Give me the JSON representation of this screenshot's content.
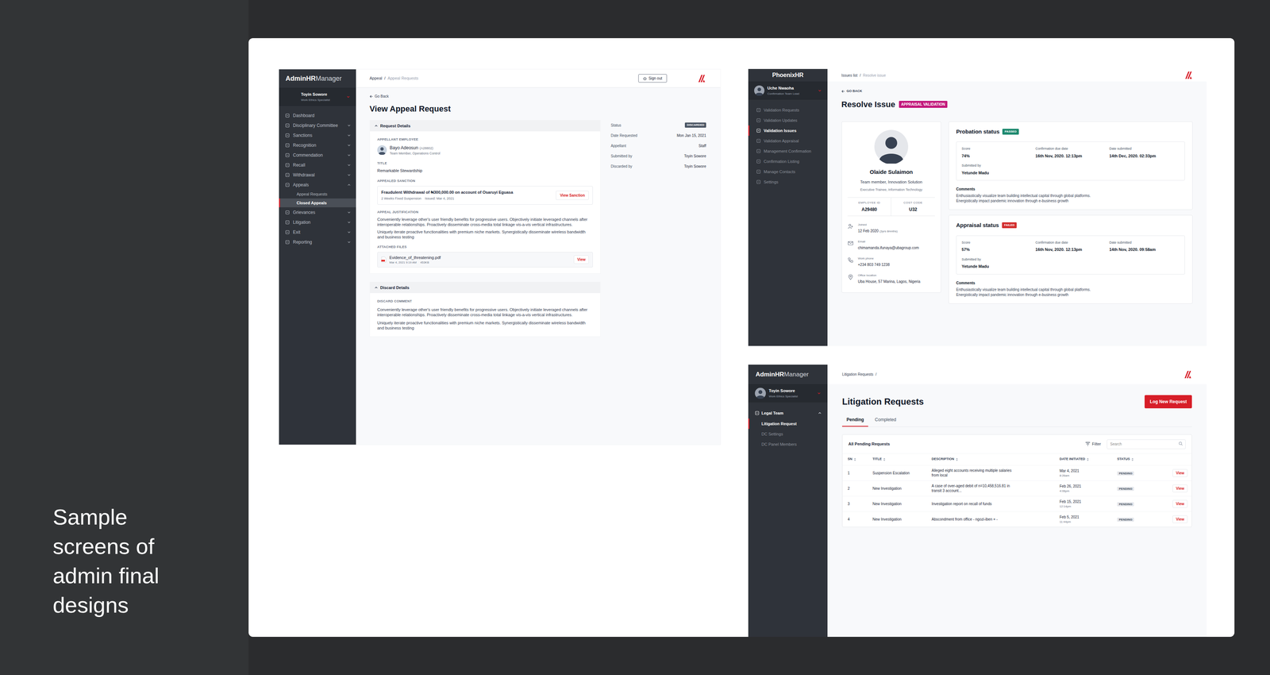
{
  "slide": {
    "caption": "Sample screens of admin final designs"
  },
  "appeal_screen": {
    "sidebar": {
      "brand_bold": "AdminHR",
      "brand_light": "Manager",
      "user": {
        "name": "Toyin Sowore",
        "role": "Work Ethics Specialist"
      },
      "items": [
        {
          "label": "Dashboard",
          "kind": "link",
          "expanded": false,
          "selected": false,
          "children": []
        },
        {
          "label": "Disciplinary Committee",
          "kind": "group",
          "expanded": false,
          "selected": false,
          "children": []
        },
        {
          "label": "Sanctions",
          "kind": "group",
          "expanded": false,
          "selected": false,
          "children": []
        },
        {
          "label": "Recognition",
          "kind": "group",
          "expanded": false,
          "selected": false,
          "children": []
        },
        {
          "label": "Commendation",
          "kind": "group",
          "expanded": false,
          "selected": false,
          "children": []
        },
        {
          "label": "Recall",
          "kind": "group",
          "expanded": false,
          "selected": false,
          "children": []
        },
        {
          "label": "Withdrawal",
          "kind": "group",
          "expanded": false,
          "selected": false,
          "children": []
        },
        {
          "label": "Appeals",
          "kind": "group",
          "expanded": true,
          "selected": false,
          "children": [
            {
              "label": "Appeal Requests",
              "selected": false
            },
            {
              "label": "Closed Appeals",
              "selected": true
            }
          ]
        },
        {
          "label": "Grievances",
          "kind": "group",
          "expanded": false,
          "selected": false,
          "children": []
        },
        {
          "label": "Litigation",
          "kind": "group",
          "expanded": false,
          "selected": false,
          "children": []
        },
        {
          "label": "Exit",
          "kind": "group",
          "expanded": false,
          "selected": false,
          "children": []
        },
        {
          "label": "Reporting",
          "kind": "group",
          "expanded": false,
          "selected": false,
          "children": []
        }
      ]
    },
    "header": {
      "breadcrumb": [
        {
          "text": "Appeal",
          "current": false
        },
        {
          "text": "/",
          "current": false
        },
        {
          "text": "Appeal Requests",
          "current": true
        }
      ],
      "sign_out": "Sign out"
    },
    "go_back": "Go Back",
    "title": "View Appeal Request",
    "request_details": {
      "heading": "Request Details",
      "expanded": true,
      "appellant_label": "APPELLANT EMPLOYEE",
      "appellant_name": "Bayo Adeosun",
      "appellant_id": "(A28802)",
      "appellant_role": "Team Member, Operations Control",
      "title_label": "TITLE",
      "title": "Remarkable Stewardship",
      "sanction_label": "APPEALED SANCTION",
      "sanction_title": "Fraudulent Withdrawal of ₦300,000.00 on account of Osaruyi Eguasa",
      "sanction_duration": "2 Weeks Fixed Suspension",
      "sanction_issued": "Issued: Mar 4, 2021",
      "view_sanction": "View Sanction",
      "justification_label": "APPEAL JUSTIFICATION",
      "justification": [
        "Conveniently leverage other's user friendly benefits for progressive users. Objectively initiate leveraged channels after interoperable relationships. Proactively disseminate cross-media total linkage vis-a-vis vertical infrastructures.",
        "Uniquely iterate proactive functionalities with premium niche markets. Synergistically disseminate wireless bandwidth and business testing"
      ],
      "files_label": "ATTACHED FILES",
      "file": {
        "name": "Evidence_of_threatening.pdf",
        "date": "Mar 4, 2021 9:19 AM",
        "size": "453KB",
        "action": "View"
      }
    },
    "discard_details": {
      "heading": "Discard Details",
      "expanded": true,
      "comment_label": "DISCARD COMMENT",
      "comment": [
        "Conveniently leverage other's user friendly benefits for progressive users. Objectively initiate leveraged channels after interoperable relationships. Proactively disseminate cross-media total linkage vis-a-vis vertical infrastructures.",
        "Uniquely iterate proactive functionalities with premium niche markets. Synergistically disseminate wireless bandwidth and business testing"
      ]
    },
    "summary": [
      {
        "label": "Status",
        "value": "DISCARDED",
        "kind": "badge"
      },
      {
        "label": "Date Requested",
        "value": "Mon Jan 15, 2021",
        "kind": "text"
      },
      {
        "label": "Appellant",
        "value": "Staff",
        "kind": "text"
      },
      {
        "label": "Submitted by",
        "value": "Toyin Sowore",
        "kind": "text"
      },
      {
        "label": "Discarded by",
        "value": "Toyin Sowore",
        "kind": "text"
      }
    ]
  },
  "resolve_screen": {
    "sidebar": {
      "brand": "PhoenixHR",
      "user": {
        "name": "Uche Nwaoha",
        "role": "Confirmation Team Lead"
      },
      "items": [
        {
          "label": "Validation Requests",
          "selected": false
        },
        {
          "label": "Validation Updates",
          "selected": false
        },
        {
          "label": "Validation Issues",
          "selected": true
        },
        {
          "label": "Validation Appraisal",
          "selected": false
        },
        {
          "label": "Management Confirmation",
          "selected": false
        },
        {
          "label": "Confirmation Listing",
          "selected": false
        },
        {
          "label": "Manage Contacts",
          "selected": false
        },
        {
          "label": "Settings",
          "selected": false
        }
      ]
    },
    "header": {
      "breadcrumb": [
        {
          "text": "Issues list",
          "current": false
        },
        {
          "text": "/",
          "current": false
        },
        {
          "text": "Resolve issue",
          "current": true
        }
      ]
    },
    "go_back": "GO BACK",
    "title": "Resolve Issue",
    "badge": "APPRAISAL VALIDATION",
    "profile": {
      "name": "Olaide Sulaimon",
      "role": "Team member, Innovation Solution",
      "department": "Executive Trainee, Information Technology",
      "ids": [
        {
          "label": "EMPLOYEE ID",
          "value": "A29480"
        },
        {
          "label": "COST CODE",
          "value": "U32"
        }
      ],
      "contacts": [
        {
          "kind": "joined",
          "label": "Joined",
          "value": "12 Feb 2020",
          "extra": "(3yrs 8mnths)"
        },
        {
          "kind": "email",
          "label": "Email",
          "value": "chimamanda.ifunaya@ubagroup.com"
        },
        {
          "kind": "phone",
          "label": "Work phone",
          "value": "+234 803 749 1238"
        },
        {
          "kind": "location",
          "label": "Office location",
          "value": "Uba House, 57 Marina, Lagos, Nigeria"
        }
      ]
    },
    "statuses": [
      {
        "title": "Probation status",
        "badge": "PASSED",
        "color": "#1f8a70",
        "fields": [
          {
            "label": "Score",
            "value": "74%"
          },
          {
            "label": "Confirmation due date",
            "value": "16th Nov, 2020. 12:13pm"
          },
          {
            "label": "Date submitted",
            "value": "14th Dec, 2020. 02:33pm"
          }
        ],
        "submitted_label": "Submitted by",
        "submitted_by": "Yetunde Madu",
        "comments_label": "Comments",
        "comments": [
          "Enthusiastically visualize team building intellectual capital through global platforms.",
          "Energistically impact pandemic innovation through e-business growth"
        ]
      },
      {
        "title": "Appraisal status",
        "badge": "FAILED",
        "color": "#d32f2f",
        "fields": [
          {
            "label": "Score",
            "value": "57%"
          },
          {
            "label": "Confirmation due date",
            "value": "16th Nov, 2020. 12:13pm"
          },
          {
            "label": "Date submitted",
            "value": "14th Nov, 2020. 09:58am"
          }
        ],
        "submitted_label": "Submitted by",
        "submitted_by": "Yetunde Madu",
        "comments_label": "Comments",
        "comments": [
          "Enthusiastically visualize team building intellectual capital through global platforms.",
          "Energistically impact pandemic innovation through e-business growth"
        ]
      }
    ]
  },
  "litigation_screen": {
    "sidebar": {
      "brand_bold": "AdminHR",
      "brand_light": "Manager",
      "user": {
        "name": "Toyin Sowore",
        "role": "Work Ethics Specialist"
      },
      "group": {
        "label": "Legal Team",
        "expanded": true
      },
      "items": [
        {
          "label": "Litigation Request",
          "selected": true
        },
        {
          "label": "DC Settings",
          "selected": false
        },
        {
          "label": "DC Panel Members",
          "selected": false
        }
      ]
    },
    "header": {
      "breadcrumb": [
        {
          "text": "Litigation Requests",
          "current": false
        },
        {
          "text": "/",
          "current": false
        }
      ]
    },
    "title": "Litigation Requests",
    "new_button": "Log New Request",
    "tabs": [
      {
        "label": "Pending",
        "selected": true
      },
      {
        "label": "Completed",
        "selected": false
      }
    ],
    "table": {
      "heading": "All Pending Requests",
      "filter": "Filter",
      "search_placeholder": "Search",
      "columns": [
        "SN",
        "TITLE",
        "DESCRIPTION",
        "DATE INITIATED",
        "STATUS"
      ],
      "rows": [
        {
          "sn": "1",
          "title": "Suspension Escalation",
          "description": "Alleged eight accounts receiving  multiple salaries from local",
          "date": "Mar 4, 2021",
          "time": "8:26am",
          "status": "PENDING",
          "action": "View"
        },
        {
          "sn": "2",
          "title": "New Investigation",
          "description": "A case of over-aged debit of n=10,458,516.81 in transit 3 account...",
          "date": "Feb 26, 2021",
          "time": "4:06pm",
          "status": "PENDING",
          "action": "View"
        },
        {
          "sn": "3",
          "title": "New Investigation",
          "description": "Investigation report on recall of funds",
          "date": "Feb 15, 2021",
          "time": "12:14pm",
          "status": "PENDING",
          "action": "View"
        },
        {
          "sn": "4",
          "title": "New Investigation",
          "description": "Abscondment from office - ngozi-iben + -",
          "date": "Feb 5, 2021",
          "time": "11:44pm",
          "status": "PENDING",
          "action": "View"
        }
      ]
    }
  }
}
